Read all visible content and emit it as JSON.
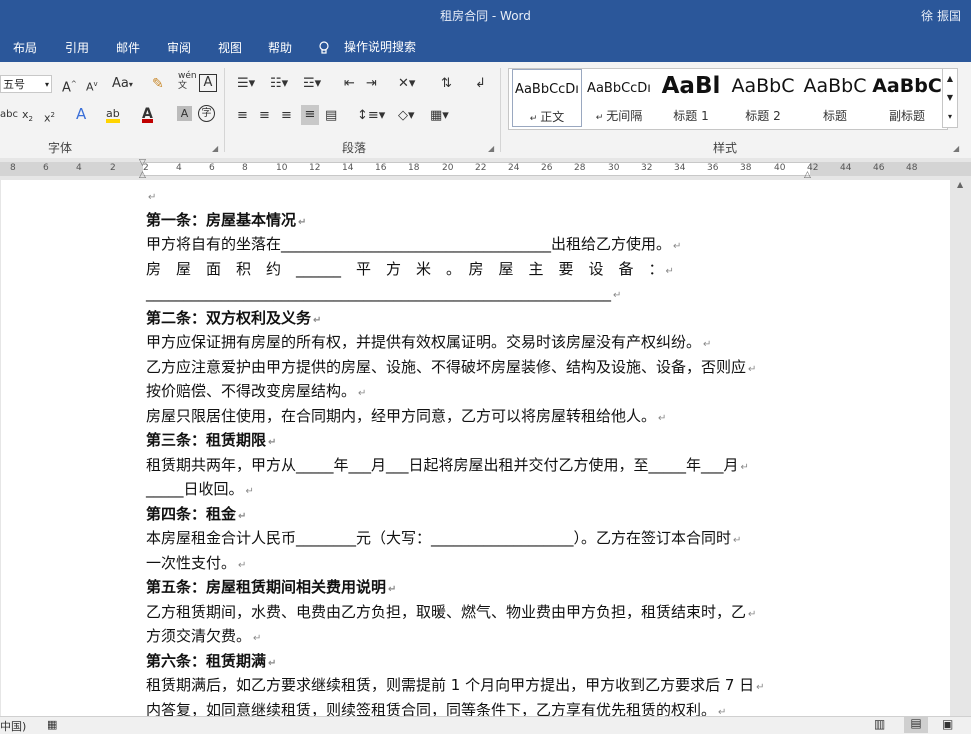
{
  "window": {
    "title": "租房合同  -  Word",
    "user": "徐 振国"
  },
  "tabs": [
    "布局",
    "引用",
    "邮件",
    "审阅",
    "视图",
    "帮助"
  ],
  "tell_me": "操作说明搜索",
  "ribbon": {
    "font_size": "五号",
    "case_button": "Aa",
    "groups": {
      "font": "字体",
      "paragraph": "段落",
      "styles": "样式"
    },
    "styles": [
      {
        "sample": "AaBbCcDı",
        "name": "正文",
        "selected": true
      },
      {
        "sample": "AaBbCcDı",
        "name": "无间隔"
      },
      {
        "sample": "AaBl",
        "name": "标题 1"
      },
      {
        "sample": "AaBbC",
        "name": "标题 2"
      },
      {
        "sample": "AaBbC",
        "name": "标题"
      },
      {
        "sample": "AaBbC",
        "name": "副标题"
      }
    ]
  },
  "ruler": {
    "labels": [
      "8",
      "6",
      "4",
      "2",
      "2",
      "4",
      "6",
      "8",
      "10",
      "12",
      "14",
      "16",
      "18",
      "20",
      "22",
      "24",
      "26",
      "28",
      "30",
      "32",
      "34",
      "36",
      "38",
      "40",
      "42",
      "44",
      "46",
      "48"
    ]
  },
  "document": {
    "paragraphs": [
      {
        "text": "",
        "bold": false
      },
      {
        "text": "第一条：房屋基本情况",
        "bold": true
      },
      {
        "text": "甲方将自有的坐落在____________________________________出租给乙方使用。",
        "bold": false
      },
      {
        "text": "房　屋　面　积　约　______　平　方　米　。　房　屋　主　要　设　备　：",
        "bold": false
      },
      {
        "text": "______________________________________________________________",
        "bold": false
      },
      {
        "text": "第二条：双方权利及义务",
        "bold": true
      },
      {
        "text": "甲方应保证拥有房屋的所有权，并提供有效权属证明。交易时该房屋没有产权纠纷。",
        "bold": false
      },
      {
        "text": "乙方应注意爱护由甲方提供的房屋、设施、不得破坏房屋装修、结构及设施、设备，否则应",
        "bold": false
      },
      {
        "text": "按价赔偿、不得改变房屋结构。",
        "bold": false
      },
      {
        "text": "房屋只限居住使用，在合同期内，经甲方同意，乙方可以将房屋转租给他人。",
        "bold": false
      },
      {
        "text": "第三条：租赁期限",
        "bold": true
      },
      {
        "text": "租赁期共两年，甲方从_____年___月___日起将房屋出租并交付乙方使用，至_____年___月",
        "bold": false
      },
      {
        "text": "_____日收回。",
        "bold": false
      },
      {
        "text": "第四条：租金",
        "bold": true
      },
      {
        "text": "本房屋租金合计人民币________元（大写：___________________）。乙方在签订本合同时",
        "bold": false
      },
      {
        "text": "一次性支付。",
        "bold": false
      },
      {
        "text": "第五条：房屋租赁期间相关费用说明",
        "bold": true
      },
      {
        "text": "乙方租赁期间，水费、电费由乙方负担，取暖、燃气、物业费由甲方负担，租赁结束时，乙",
        "bold": false
      },
      {
        "text": "方须交清欠费。",
        "bold": false
      },
      {
        "text": "第六条：租赁期满",
        "bold": true
      },
      {
        "text": "租赁期满后，如乙方要求继续租赁，则需提前 1 个月向甲方提出，甲方收到乙方要求后 7 日",
        "bold": false
      },
      {
        "text": "内答复，如同意继续租赁，则续签租赁合同，同等条件下，乙方享有优先租赁的权利。",
        "bold": false
      }
    ],
    "paragraph_mark": "↵"
  },
  "status": {
    "language": "中国)"
  }
}
